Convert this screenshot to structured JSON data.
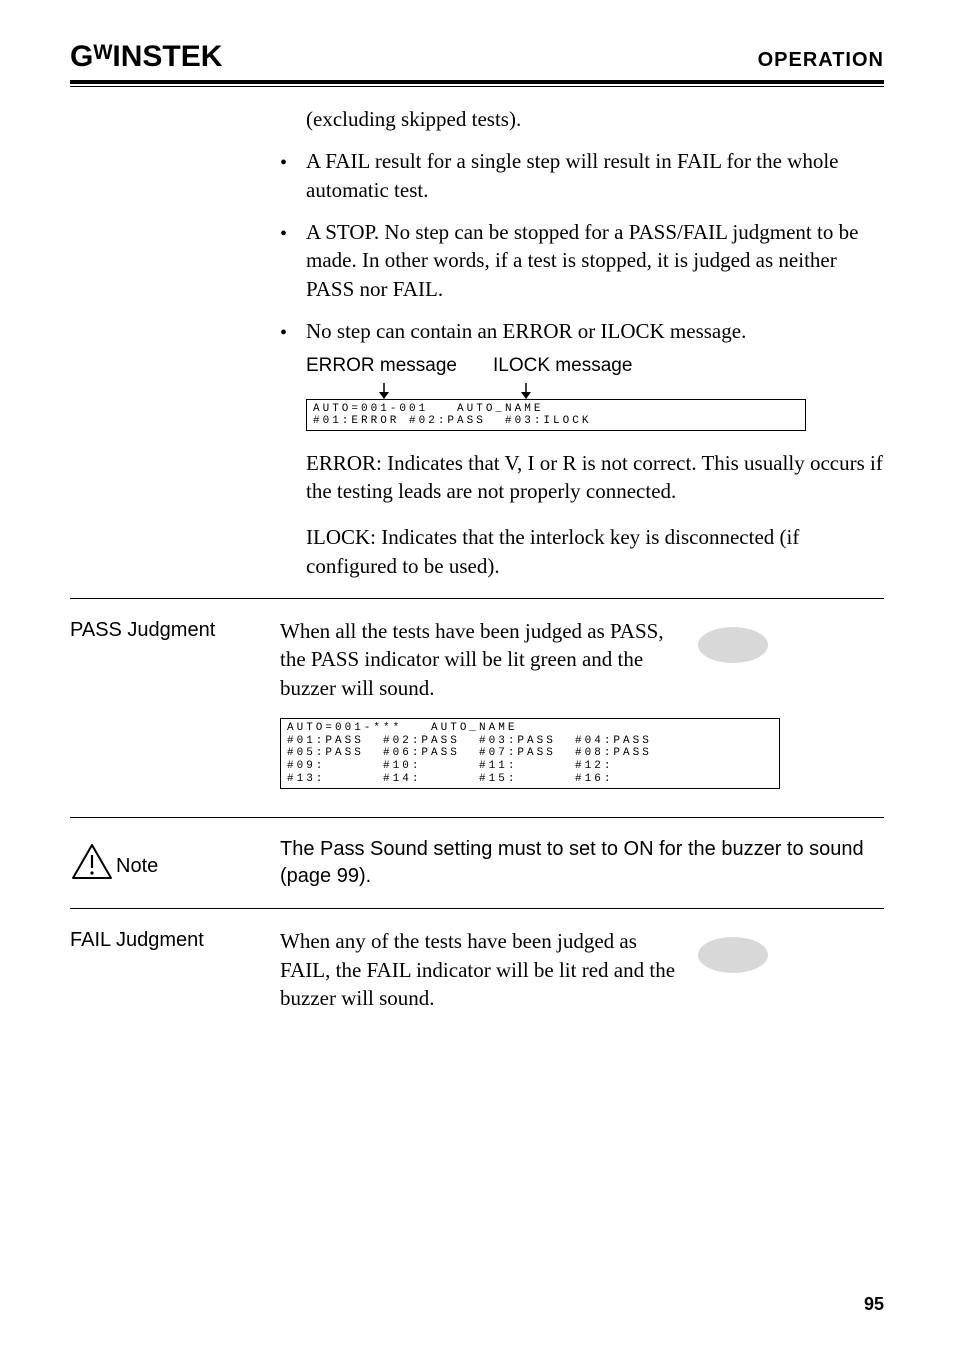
{
  "header": {
    "logo": "GᵂINSTEK",
    "section": "OPERATION"
  },
  "intro_tail": "(excluding skipped tests).",
  "bullets": [
    "A FAIL result for a single step will result in FAIL for the whole automatic test.",
    "A STOP. No step can be stopped for a PASS/FAIL judgment to be made. In other words, if a test is stopped, it is judged as neither PASS nor FAIL.",
    "No step can contain an ERROR or ILOCK message."
  ],
  "err_labels": {
    "left": "ERROR message",
    "right": "ILOCK message"
  },
  "lcd_error": "AUTO=001-001   AUTO_NAME\n#01:ERROR #02:PASS  #03:ILOCK",
  "error_desc": "ERROR: Indicates that V, I or R is not correct. This usually occurs if the testing leads are not properly connected.",
  "ilock_desc": "ILOCK: Indicates that the interlock key is disconnected (if configured to be used).",
  "pass": {
    "label": "PASS Judgment",
    "text": "When all the tests have been judged as PASS, the PASS indicator will be lit green and the buzzer will sound."
  },
  "lcd_pass": "AUTO=001-***   AUTO_NAME\n#01:PASS  #02:PASS  #03:PASS  #04:PASS\n#05:PASS  #06:PASS  #07:PASS  #08:PASS\n#09:      #10:      #11:      #12:\n#13:      #14:      #15:      #16:",
  "note": {
    "label": "Note",
    "text": "The Pass Sound setting must to set to ON for the buzzer to sound (page 99)."
  },
  "fail": {
    "label": "FAIL Judgment",
    "text": "When any of the tests have been judged as FAIL, the FAIL indicator will be lit red and the buzzer will sound."
  },
  "page_number": "95"
}
